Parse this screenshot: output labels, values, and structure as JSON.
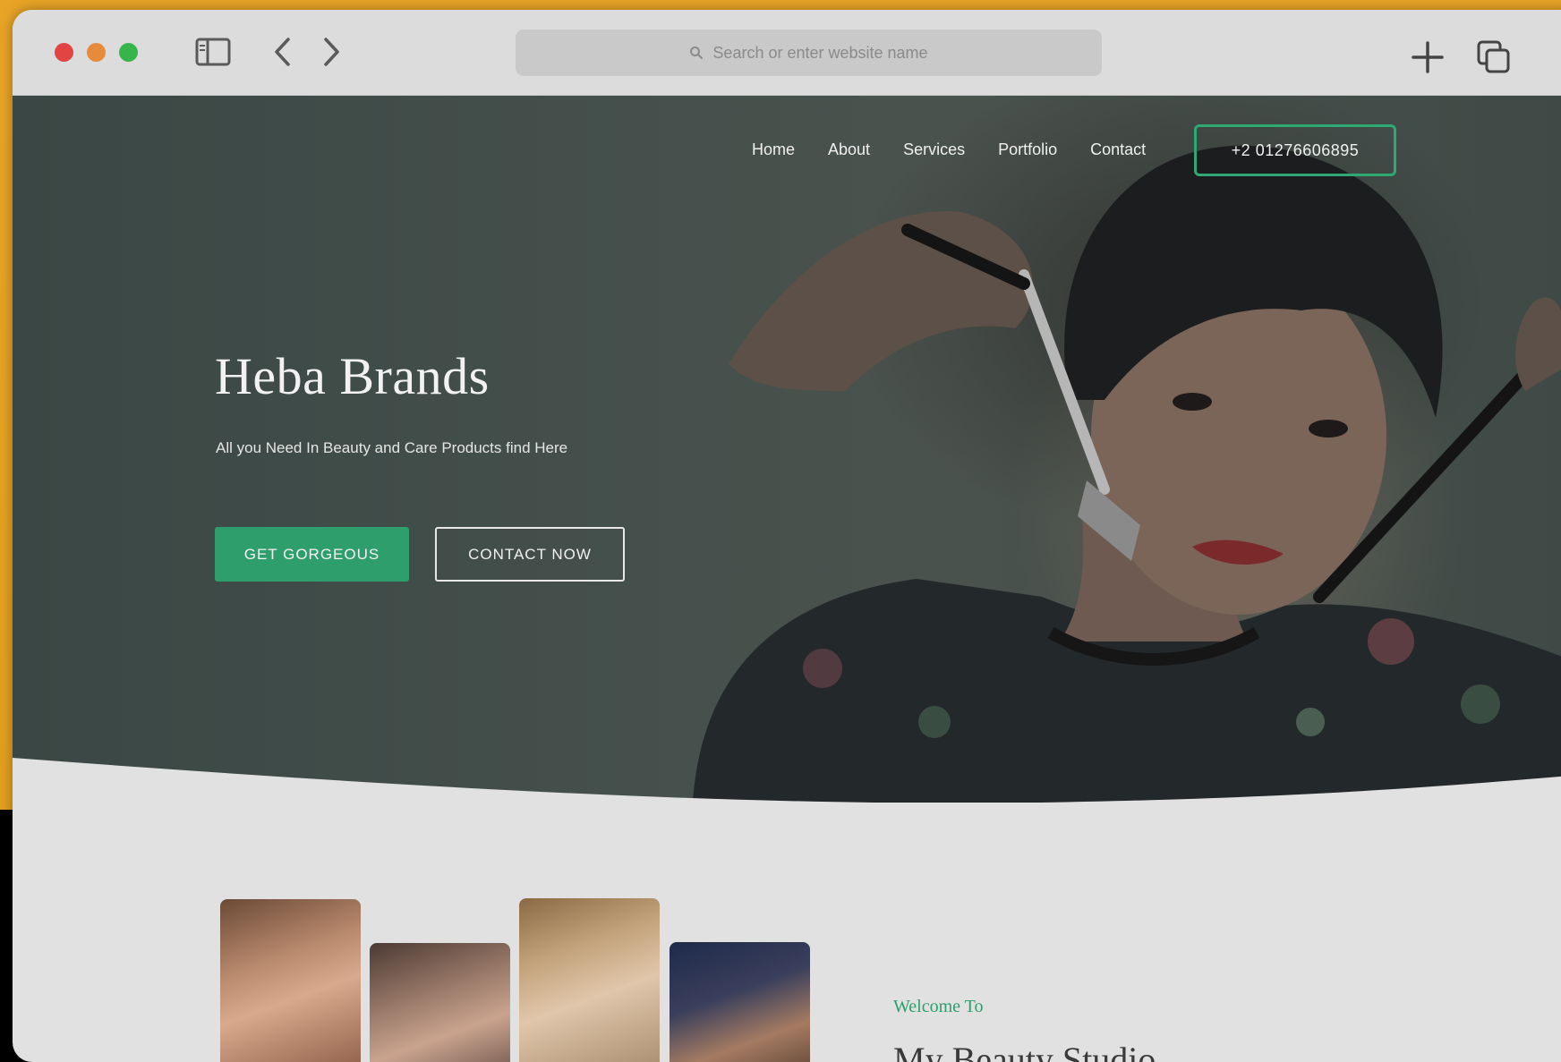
{
  "browser": {
    "address_placeholder": "Search or enter website name"
  },
  "nav": {
    "items": [
      "Home",
      "About",
      "Services",
      "Portfolio",
      "Contact"
    ],
    "phone": "+2 01276606895"
  },
  "hero": {
    "title": "Heba Brands",
    "subtitle": "All you Need In Beauty and Care Products find Here",
    "primary_button": "GET GORGEOUS",
    "secondary_button": "CONTACT NOW"
  },
  "about": {
    "welcome": "Welcome To",
    "heading": "My Beauty Studio"
  },
  "colors": {
    "accent": "#2e9e6c",
    "backdrop": "#e3a01f"
  }
}
